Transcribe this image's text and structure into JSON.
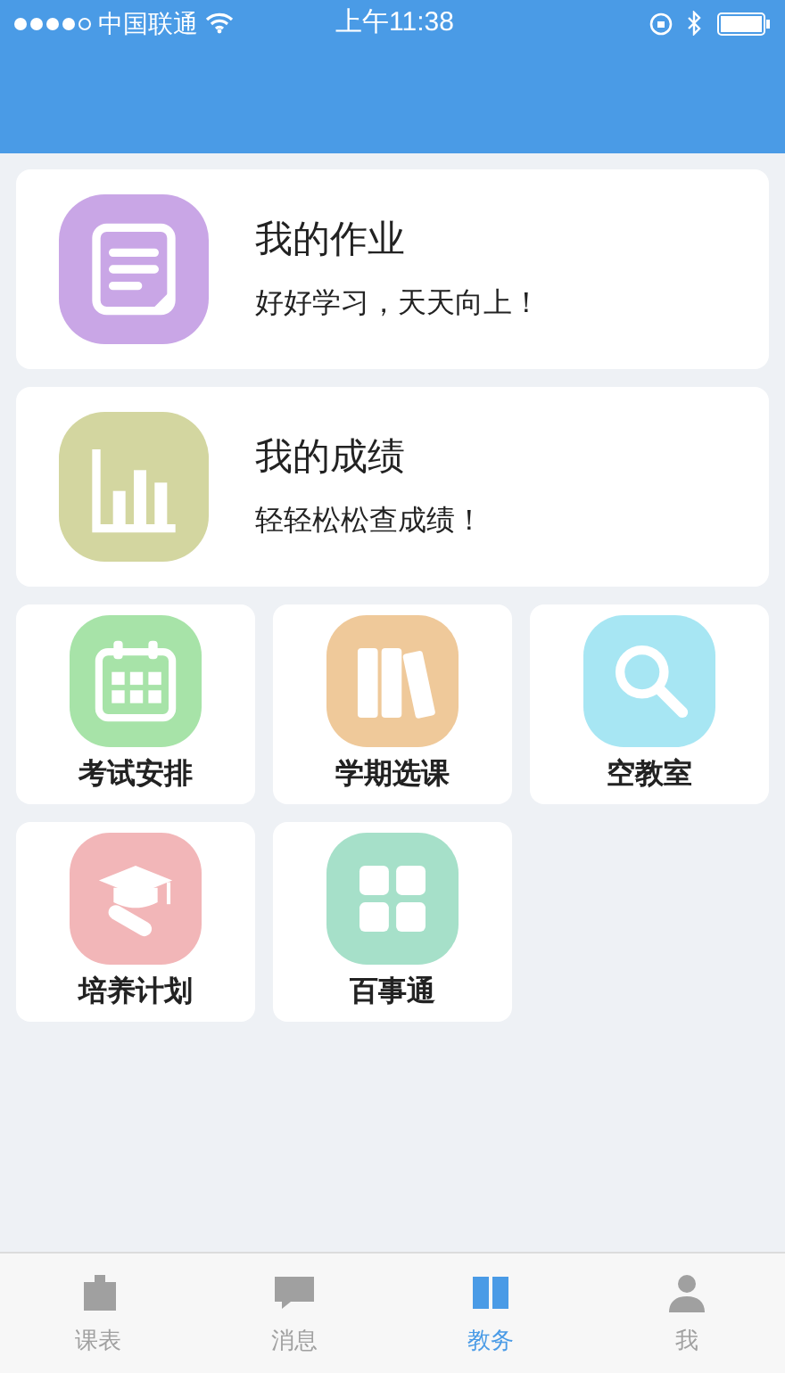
{
  "status_bar": {
    "carrier": "中国联通",
    "time": "上午11:38"
  },
  "cards": [
    {
      "title": "我的作业",
      "subtitle": "好好学习，天天向上！",
      "kind": "note",
      "color": "#c9a6e6"
    },
    {
      "title": "我的成绩",
      "subtitle": "轻轻松松查成绩！",
      "kind": "chart",
      "color": "#d3d6a0"
    }
  ],
  "tiles": [
    {
      "label": "考试安排",
      "kind": "calendar",
      "color": "#a7e3a8"
    },
    {
      "label": "学期选课",
      "kind": "books",
      "color": "#efc99a"
    },
    {
      "label": "空教室",
      "kind": "search",
      "color": "#a7e6f3"
    },
    {
      "label": "培养计划",
      "kind": "cap",
      "color": "#f2b6b8"
    },
    {
      "label": "百事通",
      "kind": "grid",
      "color": "#a6e0c9"
    }
  ],
  "tab_bar": [
    {
      "label": "课表",
      "kind": "building",
      "selected": false
    },
    {
      "label": "消息",
      "kind": "chat",
      "selected": false
    },
    {
      "label": "教务",
      "kind": "book",
      "selected": true
    },
    {
      "label": "我",
      "kind": "person",
      "selected": false
    }
  ]
}
